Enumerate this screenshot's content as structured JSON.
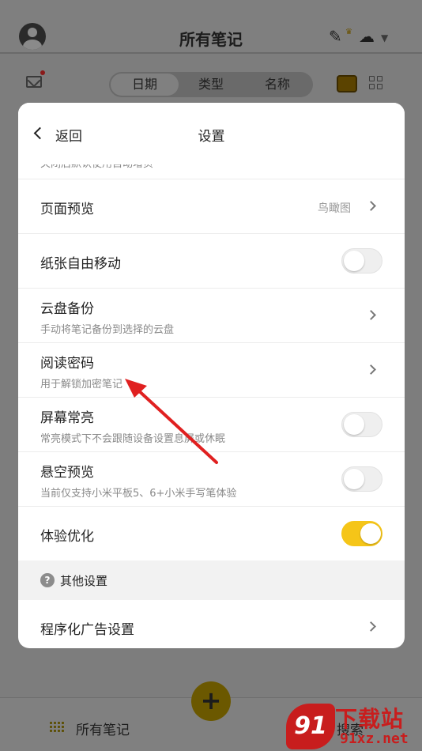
{
  "app": {
    "title": "所有笔记",
    "icons": [
      "avatar",
      "edit-icon",
      "cloud-upload-icon",
      "dropdown-icon",
      "mail-icon",
      "treasure-chest-icon",
      "grid-icon"
    ]
  },
  "sort_tabs": [
    {
      "label": "日期",
      "active": true
    },
    {
      "label": "类型",
      "active": false
    },
    {
      "label": "名称",
      "active": false
    }
  ],
  "settings": {
    "back_label": "返回",
    "title": "设置",
    "partial_top_text": "关闭后默认使用自动增页",
    "rows": [
      {
        "title": "页面预览",
        "value": "鸟瞰图",
        "control": "chevron"
      },
      {
        "title": "纸张自由移动",
        "control": "toggle",
        "on": false
      },
      {
        "title": "云盘备份",
        "subtitle": "手动将笔记备份到选择的云盘",
        "control": "chevron"
      },
      {
        "title": "阅读密码",
        "subtitle": "用于解锁加密笔记",
        "control": "chevron"
      },
      {
        "title": "屏幕常亮",
        "subtitle": "常亮模式下不会跟随设备设置息屏或休眠",
        "control": "toggle",
        "on": false
      },
      {
        "title": "悬空预览",
        "subtitle": "当前仅支持小米平板5、6+小米手写笔体验",
        "control": "toggle",
        "on": false
      },
      {
        "title": "体验优化",
        "control": "toggle",
        "on": true
      }
    ],
    "section_label": "其他设置",
    "last_row_title": "程序化广告设置"
  },
  "bottom_bar": {
    "left_label": "所有笔记",
    "fab_label": "+",
    "right_label": "搜索"
  },
  "watermark": {
    "badge": "91",
    "top": "下载站",
    "bottom": "91xz.net"
  },
  "colors": {
    "accent": "#f5c518",
    "arrow": "#e02020",
    "watermark": "#c81d1d"
  }
}
